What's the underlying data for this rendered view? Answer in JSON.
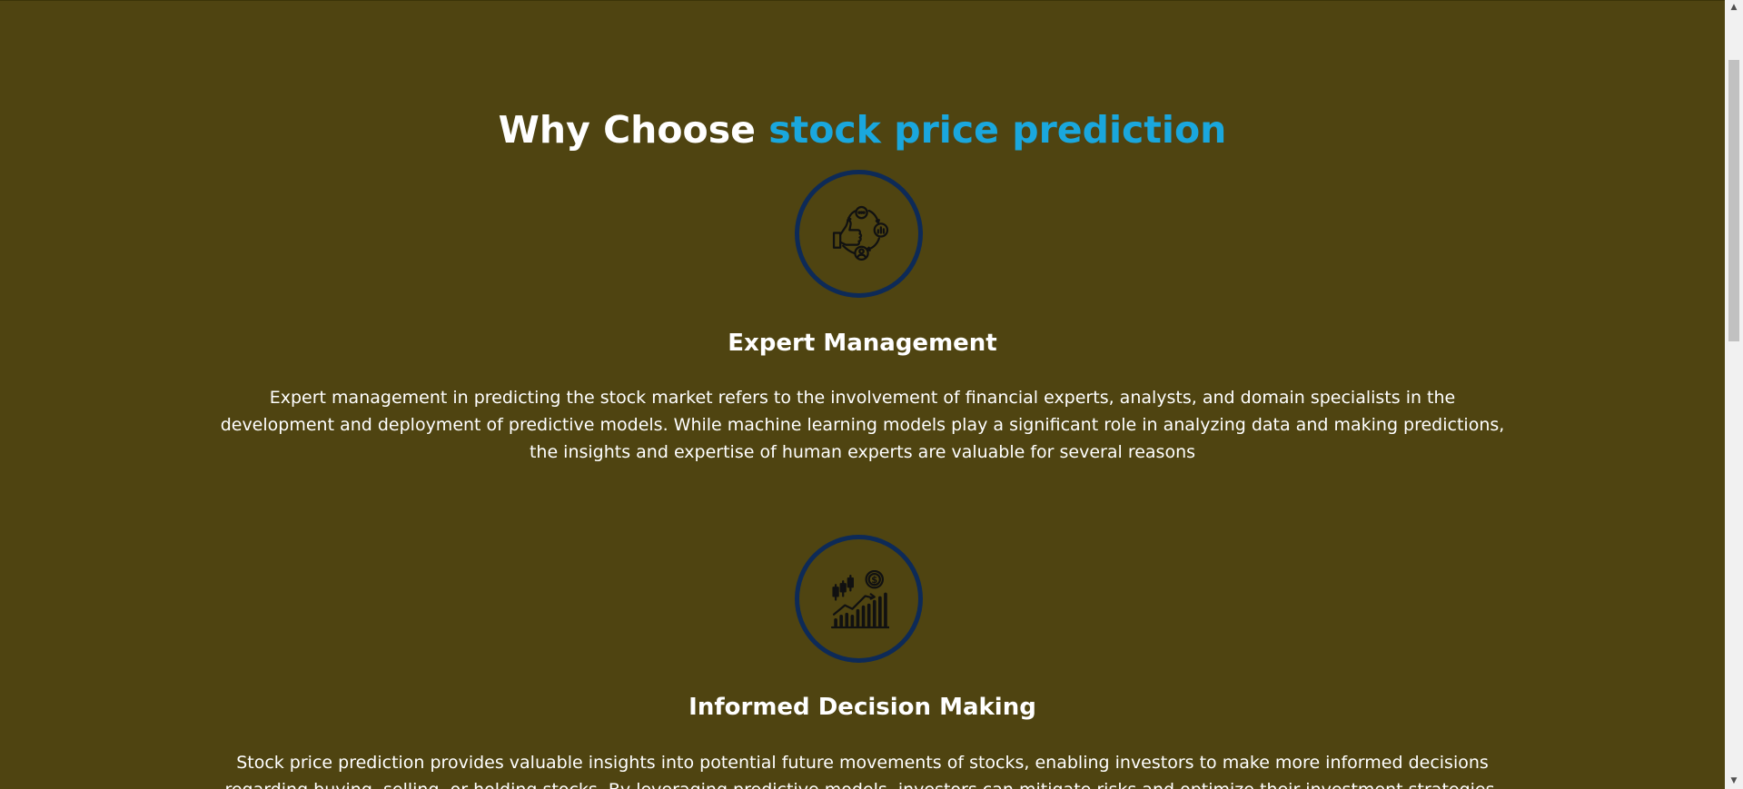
{
  "section": {
    "title_prefix": "Why Choose",
    "title_accent": "stock price prediction"
  },
  "features": [
    {
      "icon": "expert-management-icon",
      "title": "Expert Management",
      "text": "Expert management in predicting the stock market refers to the involvement of financial experts, analysts, and domain specialists in the development and deployment of predictive models. While machine learning models play a significant role in analyzing data and making predictions, the insights and expertise of human experts are valuable for several reasons"
    },
    {
      "icon": "stock-growth-chart-icon",
      "title": "Informed Decision Making",
      "text": "Stock price prediction provides valuable insights into potential future movements of stocks, enabling investors to make more informed decisions regarding buying, selling, or holding stocks. By leveraging predictive models, investors can mitigate risks and optimize their investment strategies."
    }
  ],
  "scrollbar": {
    "up_arrow": "▲",
    "down_arrow": "▼"
  },
  "colors": {
    "background": "#4f4411",
    "accent": "#1aa7dd",
    "icon_ring": "#0d2a57",
    "text": "#ffffff"
  }
}
